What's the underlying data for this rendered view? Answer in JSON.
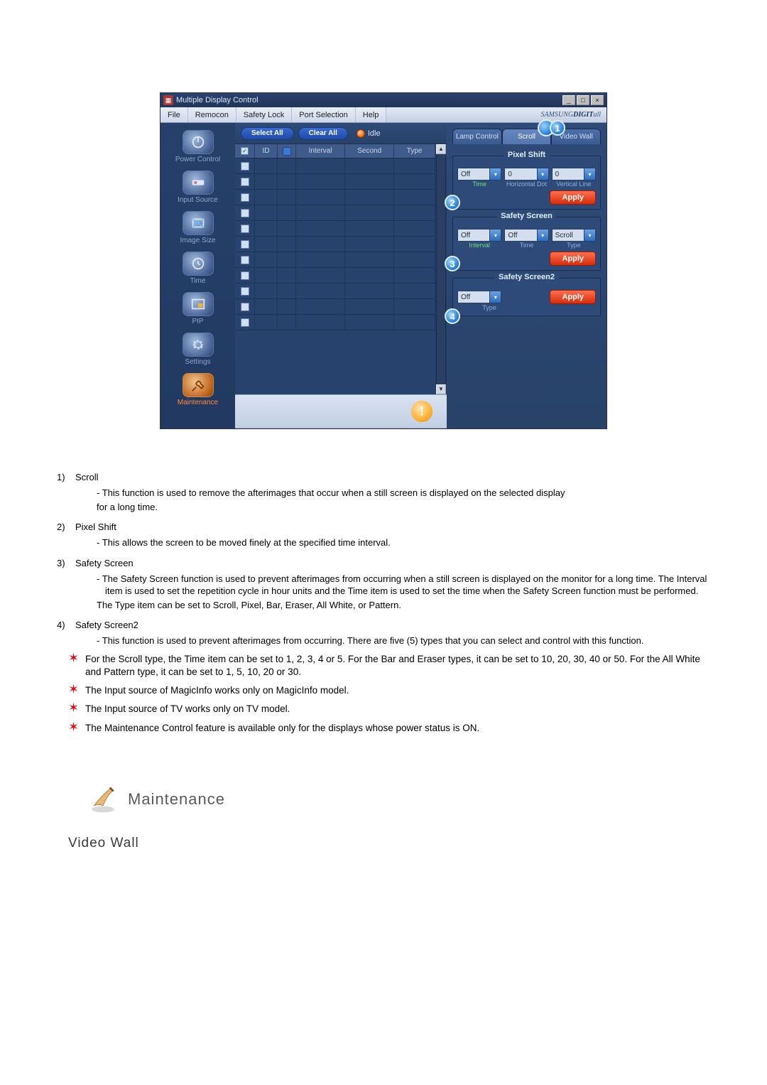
{
  "window": {
    "title": "Multiple Display Control",
    "brand_prefix": "SAMSUNG ",
    "brand_emph": "DIGIT",
    "brand_suffix": "all"
  },
  "menubar": {
    "items": [
      "File",
      "Remocon",
      "Safety Lock",
      "Port Selection",
      "Help"
    ]
  },
  "sidebar": {
    "items": [
      {
        "label": "Power Control",
        "active": false
      },
      {
        "label": "Input Source",
        "active": false
      },
      {
        "label": "Image Size",
        "active": false
      },
      {
        "label": "Time",
        "active": false
      },
      {
        "label": "PIP",
        "active": false
      },
      {
        "label": "Settings",
        "active": false
      },
      {
        "label": "Maintenance",
        "active": true
      }
    ]
  },
  "toolbar": {
    "select_all": "Select All",
    "clear_all": "Clear All",
    "idle_label": "Idle"
  },
  "table": {
    "headers": {
      "id": "ID",
      "interval": "Interval",
      "second": "Second",
      "type": "Type"
    },
    "row_count": 11
  },
  "tabs": {
    "items": [
      {
        "label": "Lamp Control",
        "active": false
      },
      {
        "label": "Scroll",
        "active": true
      },
      {
        "label": "Video Wall",
        "active": false
      }
    ]
  },
  "pixel_shift": {
    "legend": "Pixel Shift",
    "time_value": "Off",
    "hdot_value": "0",
    "vline_value": "0",
    "time_label": "Time",
    "hdot_label": "Horizontal Dot",
    "vline_label": "Vertical Line",
    "apply": "Apply"
  },
  "safety_screen": {
    "legend": "Safety Screen",
    "interval_value": "Off",
    "time_value": "Off",
    "type_value": "Scroll",
    "interval_label": "Interval",
    "time_label": "Time",
    "type_label": "Type",
    "apply": "Apply"
  },
  "safety_screen2": {
    "legend": "Safety Screen2",
    "type_value": "Off",
    "type_label": "Type",
    "apply": "Apply"
  },
  "callouts": {
    "c1": "1",
    "c2": "2",
    "c3": "3",
    "c4": "4"
  },
  "body": {
    "i1_num": "1)",
    "i1_title": "Scroll",
    "i1_a": "- This function is used to remove the afterimages that occur when a still screen is displayed on the selected display",
    "i1_b": "for a long time.",
    "i2_num": "2)",
    "i2_title": "Pixel Shift",
    "i2_a": "- This allows the screen to be moved finely at the specified time interval.",
    "i3_num": "3)",
    "i3_title": "Safety Screen",
    "i3_a": "- The Safety Screen function is used to prevent afterimages from occurring when a still screen is displayed on the monitor for a long time.  The Interval item is used to set the repetition cycle in hour units and the Time item is used to set the time when the Safety Screen function must be performed.",
    "i3_b": "The Type item can be set to Scroll, Pixel, Bar, Eraser, All White, or Pattern.",
    "i4_num": "4)",
    "i4_title": "Safety Screen2",
    "i4_a": "- This function is used to prevent afterimages from occurring. There are five (5) types that you can select and control with this function.",
    "s1": "For the Scroll type, the Time item can be set to 1, 2, 3, 4 or 5. For the Bar and Eraser types, it can be set to 10, 20, 30, 40 or 50. For the All White and Pattern type, it can be set to 1, 5, 10, 20 or 30.",
    "s2": "The Input source of MagicInfo works only on MagicInfo model.",
    "s3": "The Input source of TV works only on TV model.",
    "s4": "The Maintenance Control feature is available only for the displays whose power status is ON."
  },
  "headings": {
    "maintenance": "Maintenance",
    "video_wall": "Video Wall"
  }
}
